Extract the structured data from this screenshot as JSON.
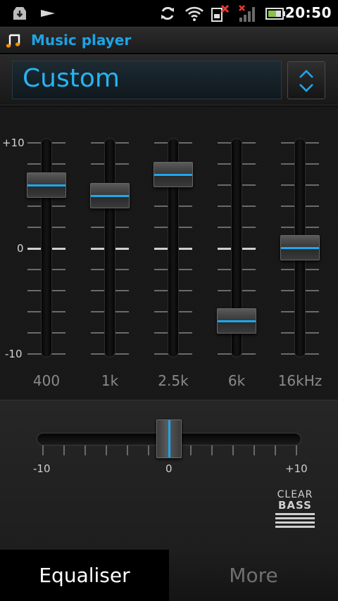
{
  "status_bar": {
    "time": "20:50",
    "icons": [
      "download-icon",
      "play-icon",
      "sync-icon",
      "wifi-icon",
      "sim-error-icon",
      "signal-off-icon",
      "battery-icon"
    ]
  },
  "title_bar": {
    "icon": "music-note-icon",
    "title": "Music player",
    "accent_color": "#1da3e6"
  },
  "preset": {
    "value": "Custom",
    "selector_icon": "up-down-chevron-icon"
  },
  "equalizer": {
    "scale_labels": {
      "top": "+10",
      "middle": "0",
      "bottom": "-10"
    },
    "range": [
      -10,
      10
    ],
    "bands": [
      {
        "label": "400",
        "level": 6
      },
      {
        "label": "1k",
        "level": 5
      },
      {
        "label": "2.5k",
        "level": 7
      },
      {
        "label": "6k",
        "level": -7
      },
      {
        "label": "16kHz",
        "level": 0
      }
    ],
    "indicator_color": "#1ea7ec"
  },
  "clear_bass": {
    "labels": {
      "min": "-10",
      "mid": "0",
      "max": "+10"
    },
    "level": 0,
    "logo_line1": "CLEAR",
    "logo_line2": "BASS"
  },
  "tabs": [
    {
      "label": "Equaliser",
      "selected": true
    },
    {
      "label": "More",
      "selected": false
    }
  ]
}
